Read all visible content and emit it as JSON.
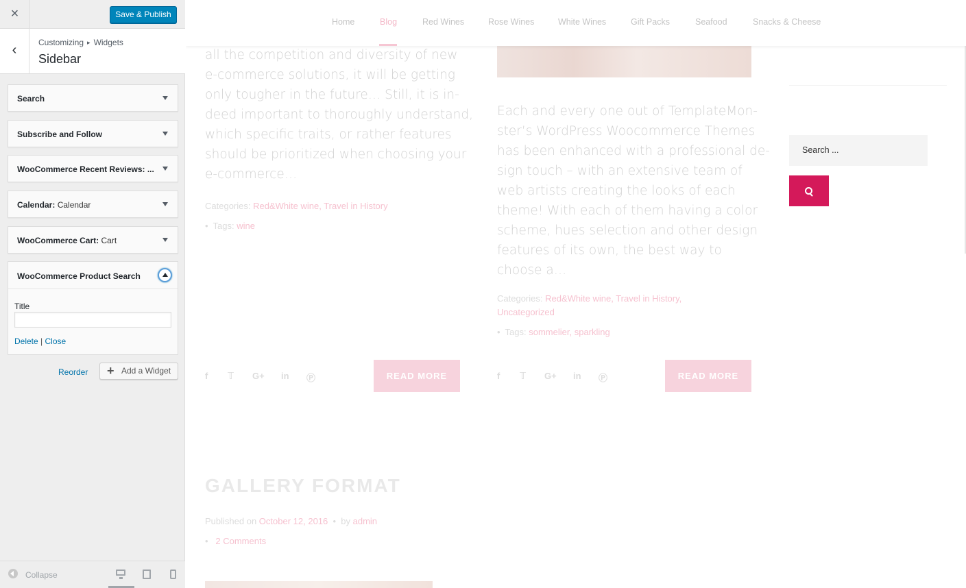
{
  "customizer": {
    "close_icon": "×",
    "save_label": "Save & Publish",
    "breadcrumb": {
      "first": "Customizing",
      "sep": "▸",
      "second": "Widgets"
    },
    "section_title": "Sidebar",
    "widgets": [
      {
        "label": "Search",
        "sub": ""
      },
      {
        "label": "Subscribe and Follow",
        "sub": ""
      },
      {
        "label": "WooCommerce Recent Reviews: ...",
        "sub": ""
      },
      {
        "label": "Calendar:",
        "sub": "Calendar"
      },
      {
        "label": "WooCommerce Cart:",
        "sub": "Cart"
      }
    ],
    "open_widget": {
      "title": "WooCommerce Product Search",
      "field_label": "Title",
      "field_value": "",
      "delete_label": "Delete",
      "separator": "|",
      "close_label": "Close"
    },
    "reorder_label": "Reorder",
    "add_widget_label": "Add a Widget",
    "collapse_label": "Collapse",
    "colors": {
      "primary": "#0085ba",
      "link": "#0073aa"
    }
  },
  "preview": {
    "nav": [
      "Home",
      "Blog",
      "Red Wines",
      "Rose Wines",
      "White Wines",
      "Gift Packs",
      "Seafood",
      "Snacks & Cheese"
    ],
    "active_nav": "Blog",
    "post1": {
      "excerpt": "all the competition and diversity of new\ne-commerce solutions, it will be getting\nonly tougher in the future… Still, it is in-\ndeed important to thoroughly understand,\nwhich specific traits, or rather features\nshould be prioritized when choosing your\ne-commerce…",
      "categories_label": "Categories:",
      "categories": "Red&White wine, Travel in History",
      "tags_label": "Tags:",
      "tags": "wine",
      "read_more": "READ MORE"
    },
    "post2": {
      "excerpt": "Each and every one out of TemplateMon-\nster’s WordPress Woocommerce Themes\nhas been enhanced with a professional de-\nsign touch – with an extensive team of\nweb artists creating the looks of each\ntheme! With each of them having a color\nscheme, hues selection and other design\nfeatures of its own, the best way to\nchoose a…",
      "categories_label": "Categories:",
      "categories": "Red&White wine, Travel in History,",
      "categories2": "Uncategorized",
      "tags_label": "Tags:",
      "tags": "sommelier, sparkling",
      "read_more": "READ MORE"
    },
    "gallery": {
      "title": "GALLERY FORMAT",
      "published_label": "Published on",
      "date": "October 12, 2016",
      "by_label": "by",
      "author": "admin",
      "comments": "2 Comments"
    },
    "search_placeholder": "Search ...",
    "accent_color": "#d4195a"
  }
}
